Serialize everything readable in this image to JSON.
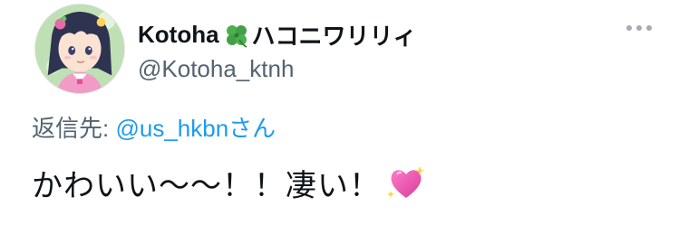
{
  "author": {
    "name": "Kotoha",
    "name_suffix": "ハコニワリリィ",
    "emoji": "four-leaf-clover",
    "handle": "@Kotoha_ktnh"
  },
  "reply_to": {
    "label": "返信先:",
    "mention": "@us_hkbn",
    "honorific": "さん"
  },
  "tweet": {
    "text": "かわいい〜〜！！凄い！",
    "emoji": "sparkling-heart"
  },
  "icons": {
    "more": "more-icon",
    "clover": "four-leaf-clover-icon",
    "heart": "sparkling-heart-icon"
  },
  "colors": {
    "text": "#0f1419",
    "secondary": "#536471",
    "link": "#1d9bf0"
  }
}
